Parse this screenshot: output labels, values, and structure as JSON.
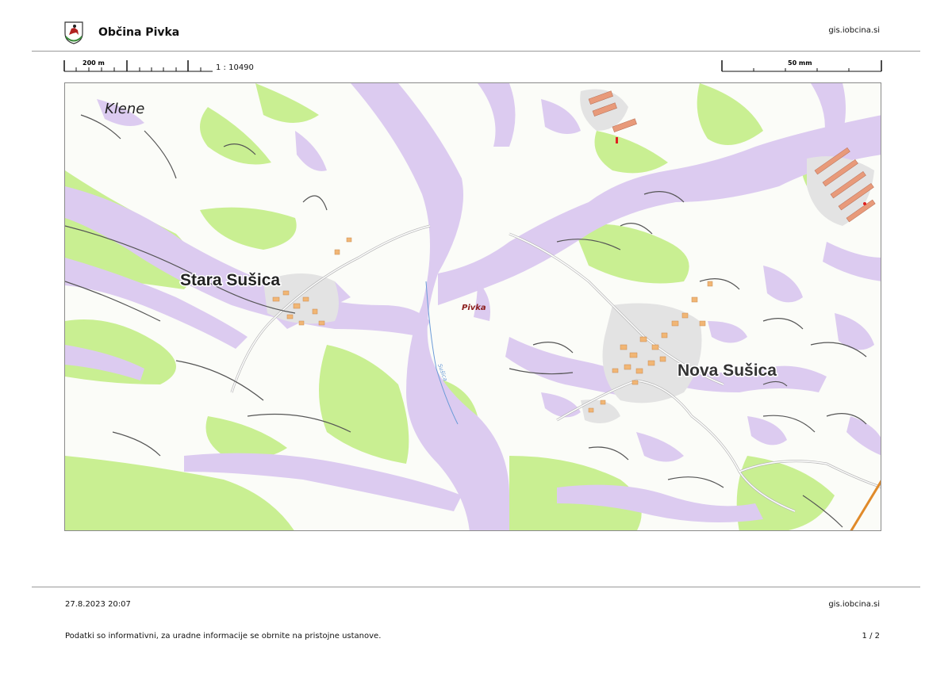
{
  "header": {
    "title": "Občina Pivka",
    "url": "gis.iobcina.si"
  },
  "scale": {
    "bar_label": "200 m",
    "ratio": "1 : 10490",
    "mm_label": "50 mm"
  },
  "map": {
    "places": {
      "klene": "Klene",
      "stara_susica": "Stara Sušica",
      "nova_susica": "Nova Sušica",
      "pivka": "Pivka",
      "susica_stream": "Sušica"
    },
    "colors": {
      "background": "#fbfcf8",
      "forest": "#c9ef92",
      "slope": "#dccbf0",
      "contour": "#555555",
      "building": "#f1b675",
      "settlement": "#e3e3e3",
      "road": "#ffffff",
      "stream": "#6b9bd8"
    }
  },
  "footer": {
    "date": "27.8.2023 20:07",
    "url": "gis.iobcina.si",
    "note": "Podatki so informativni, za uradne informacije se obrnite na pristojne ustanove.",
    "page": "1 / 2"
  }
}
